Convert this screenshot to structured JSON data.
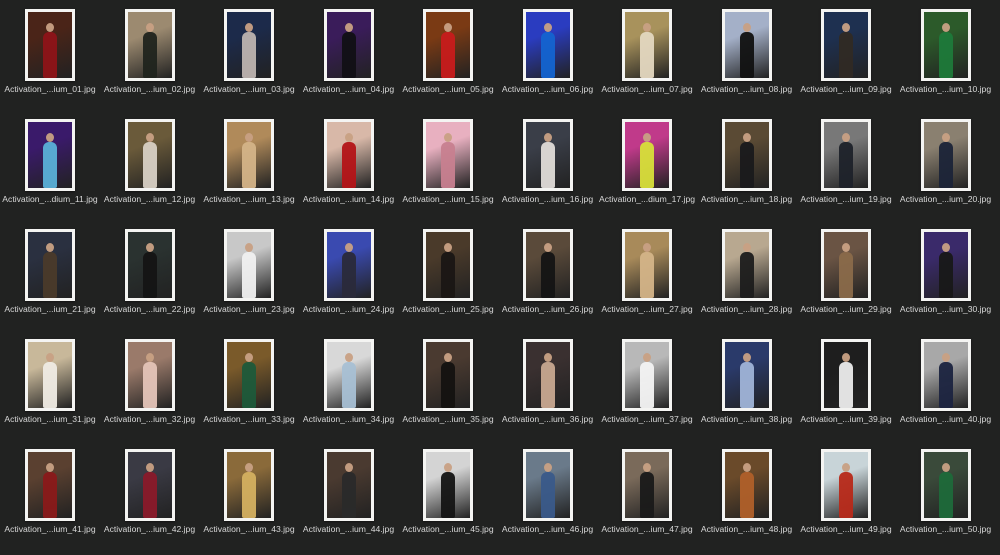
{
  "files": [
    {
      "name": "Activation_...ium_01.jpg",
      "colors": [
        "#4a2418",
        "#8e1418"
      ]
    },
    {
      "name": "Activation_...ium_02.jpg",
      "colors": [
        "#9c8a70",
        "#20241e"
      ]
    },
    {
      "name": "Activation_...ium_03.jpg",
      "colors": [
        "#1c2a4a",
        "#bdb4b0"
      ]
    },
    {
      "name": "Activation_...ium_04.jpg",
      "colors": [
        "#3a1c5a",
        "#111015"
      ]
    },
    {
      "name": "Activation_...ium_05.jpg",
      "colors": [
        "#7a3a14",
        "#c81c1c"
      ]
    },
    {
      "name": "Activation_...ium_06.jpg",
      "colors": [
        "#2a3cc0",
        "#1464d0"
      ]
    },
    {
      "name": "Activation_...ium_07.jpg",
      "colors": [
        "#a8925c",
        "#e4d8c0"
      ]
    },
    {
      "name": "Activation_...ium_08.jpg",
      "colors": [
        "#a4b0c8",
        "#111111"
      ]
    },
    {
      "name": "Activation_...ium_09.jpg",
      "colors": [
        "#1e3050",
        "#302a24"
      ]
    },
    {
      "name": "Activation_...ium_10.jpg",
      "colors": [
        "#2c5a2a",
        "#1e7a3a"
      ]
    },
    {
      "name": "Activation_...dium_11.jpg",
      "colors": [
        "#3a1a6a",
        "#5ab0d8"
      ]
    },
    {
      "name": "Activation_...ium_12.jpg",
      "colors": [
        "#6a5a3a",
        "#d8d0c4"
      ]
    },
    {
      "name": "Activation_...ium_13.jpg",
      "colors": [
        "#b08a5a",
        "#d4b488"
      ]
    },
    {
      "name": "Activation_...ium_14.jpg",
      "colors": [
        "#d8b8a8",
        "#b41418"
      ]
    },
    {
      "name": "Activation_...ium_15.jpg",
      "colors": [
        "#e8b0c0",
        "#c88090"
      ]
    },
    {
      "name": "Activation_...ium_16.jpg",
      "colors": [
        "#3a3e48",
        "#e0dcd8"
      ]
    },
    {
      "name": "Activation_...dium_17.jpg",
      "colors": [
        "#c03a8a",
        "#d8e03a"
      ]
    },
    {
      "name": "Activation_...ium_18.jpg",
      "colors": [
        "#5a4a34",
        "#1a1a1c"
      ]
    },
    {
      "name": "Activation_...ium_19.jpg",
      "colors": [
        "#787878",
        "#1e222a"
      ]
    },
    {
      "name": "Activation_...ium_20.jpg",
      "colors": [
        "#8a8070",
        "#1c2438"
      ]
    },
    {
      "name": "Activation_...ium_21.jpg",
      "colors": [
        "#2a3040",
        "#4a3a2a"
      ]
    },
    {
      "name": "Activation_...ium_22.jpg",
      "colors": [
        "#2a3230",
        "#141414"
      ]
    },
    {
      "name": "Activation_...ium_23.jpg",
      "colors": [
        "#c8c8c8",
        "#f0f0f0"
      ]
    },
    {
      "name": "Activation_...ium_24.jpg",
      "colors": [
        "#3a4ab0",
        "#2a2a3a"
      ]
    },
    {
      "name": "Activation_...ium_25.jpg",
      "colors": [
        "#4a3a2a",
        "#1a1614"
      ]
    },
    {
      "name": "Activation_...ium_26.jpg",
      "colors": [
        "#5a4a3a",
        "#141414"
      ]
    },
    {
      "name": "Activation_...ium_27.jpg",
      "colors": [
        "#a88a5a",
        "#d4b488"
      ]
    },
    {
      "name": "Activation_...ium_28.jpg",
      "colors": [
        "#b8a890",
        "#1c1c1c"
      ]
    },
    {
      "name": "Activation_...ium_29.jpg",
      "colors": [
        "#6a5444",
        "#8a6a4a"
      ]
    },
    {
      "name": "Activation_...ium_30.jpg",
      "colors": [
        "#3a2a6a",
        "#181818"
      ]
    },
    {
      "name": "Activation_...ium_31.jpg",
      "colors": [
        "#c8b89a",
        "#f0ece4"
      ]
    },
    {
      "name": "Activation_...ium_32.jpg",
      "colors": [
        "#9a7a6a",
        "#e4c4b8"
      ]
    },
    {
      "name": "Activation_...ium_33.jpg",
      "colors": [
        "#7a5a2a",
        "#1e5a3a"
      ]
    },
    {
      "name": "Activation_...ium_34.jpg",
      "colors": [
        "#d8d8d8",
        "#a8c0d4"
      ]
    },
    {
      "name": "Activation_...ium_35.jpg",
      "colors": [
        "#4a3a30",
        "#141210"
      ]
    },
    {
      "name": "Activation_...ium_36.jpg",
      "colors": [
        "#3a3030",
        "#c8a890"
      ]
    },
    {
      "name": "Activation_...ium_37.jpg",
      "colors": [
        "#b8b8b8",
        "#f4f4f4"
      ]
    },
    {
      "name": "Activation_...ium_38.jpg",
      "colors": [
        "#2a3a6a",
        "#a0b4d8"
      ]
    },
    {
      "name": "Activation_...ium_39.jpg",
      "colors": [
        "#1e1e1e",
        "#ececec"
      ]
    },
    {
      "name": "Activation_...ium_40.jpg",
      "colors": [
        "#a8a8a8",
        "#1c2440"
      ]
    },
    {
      "name": "Activation_...ium_41.jpg",
      "colors": [
        "#5a4030",
        "#8a1a1a"
      ]
    },
    {
      "name": "Activation_...ium_42.jpg",
      "colors": [
        "#3a3a44",
        "#8a1a2a"
      ]
    },
    {
      "name": "Activation_...ium_43.jpg",
      "colors": [
        "#8a6a3a",
        "#d4b060"
      ]
    },
    {
      "name": "Activation_...ium_44.jpg",
      "colors": [
        "#4a3a30",
        "#2a2a2a"
      ]
    },
    {
      "name": "Activation_...ium_45.jpg",
      "colors": [
        "#d4d4d4",
        "#141414"
      ]
    },
    {
      "name": "Activation_...ium_46.jpg",
      "colors": [
        "#6a7a8a",
        "#3a5a8a"
      ]
    },
    {
      "name": "Activation_...ium_47.jpg",
      "colors": [
        "#7a6a5a",
        "#1a1a1a"
      ]
    },
    {
      "name": "Activation_...ium_48.jpg",
      "colors": [
        "#6a4a2a",
        "#b0602a"
      ]
    },
    {
      "name": "Activation_...ium_49.jpg",
      "colors": [
        "#c8d4d8",
        "#b82a1a"
      ]
    },
    {
      "name": "Activation_...ium_50.jpg",
      "colors": [
        "#3a4a3a",
        "#1e6a3a"
      ]
    }
  ],
  "colors": {
    "background": "#212221",
    "label_text": "#d8d8d8",
    "thumbnail_frame": "#f4f4f2"
  }
}
